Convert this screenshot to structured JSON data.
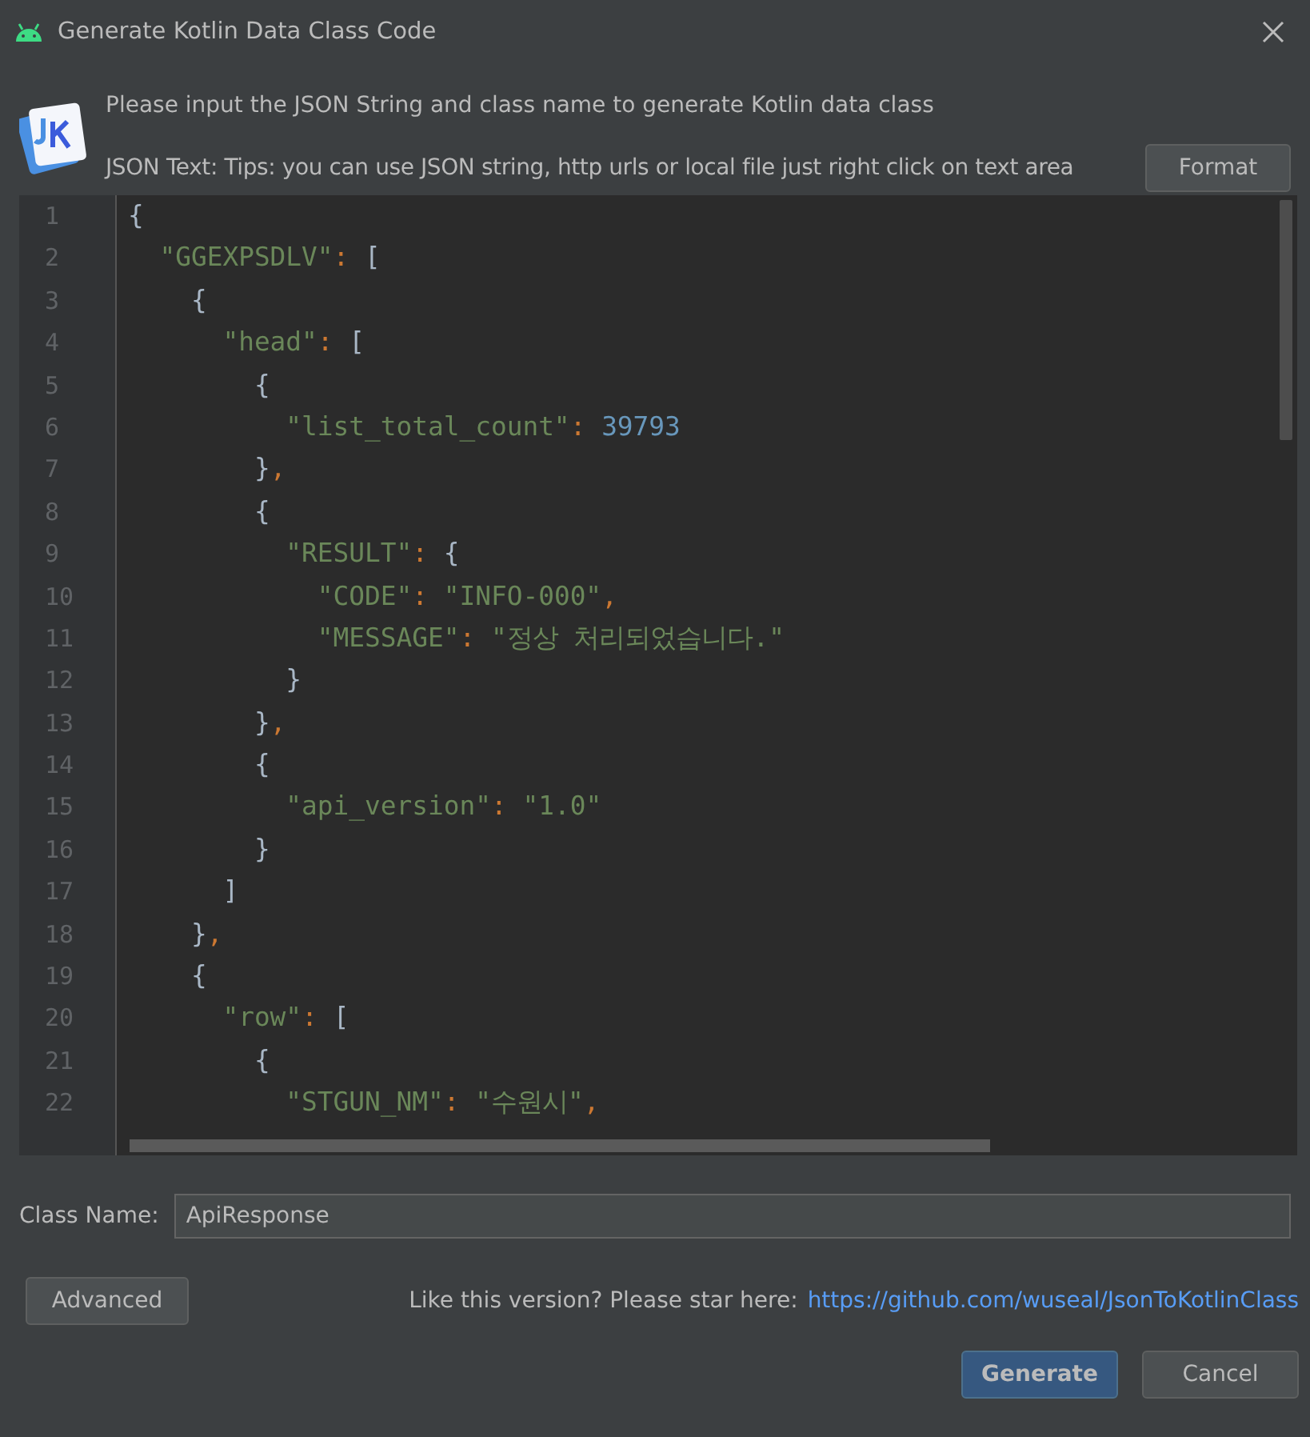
{
  "window": {
    "title": "Generate Kotlin Data Class Code"
  },
  "intro": "Please input the JSON String and class name to generate Kotlin data class",
  "json_label": "JSON Text: Tips: you can use JSON string, http urls or local file just right click on text area",
  "format_button": "Format",
  "editor": {
    "lines": [
      {
        "number": "1",
        "tokens": [
          {
            "kind": "punct",
            "text": "{"
          }
        ]
      },
      {
        "number": "2",
        "tokens": [
          {
            "kind": "key",
            "text": "  \"GGEXPSDLV\""
          },
          {
            "kind": "sep",
            "text": ": "
          },
          {
            "kind": "punct",
            "text": "["
          }
        ]
      },
      {
        "number": "3",
        "tokens": [
          {
            "kind": "punct",
            "text": "    {"
          }
        ]
      },
      {
        "number": "4",
        "tokens": [
          {
            "kind": "key",
            "text": "      \"head\""
          },
          {
            "kind": "sep",
            "text": ": "
          },
          {
            "kind": "punct",
            "text": "["
          }
        ]
      },
      {
        "number": "5",
        "tokens": [
          {
            "kind": "punct",
            "text": "        {"
          }
        ]
      },
      {
        "number": "6",
        "tokens": [
          {
            "kind": "key",
            "text": "          \"list_total_count\""
          },
          {
            "kind": "sep",
            "text": ": "
          },
          {
            "kind": "num",
            "text": "39793"
          }
        ]
      },
      {
        "number": "7",
        "tokens": [
          {
            "kind": "punct",
            "text": "        }"
          },
          {
            "kind": "sep",
            "text": ","
          }
        ]
      },
      {
        "number": "8",
        "tokens": [
          {
            "kind": "punct",
            "text": "        {"
          }
        ]
      },
      {
        "number": "9",
        "tokens": [
          {
            "kind": "key",
            "text": "          \"RESULT\""
          },
          {
            "kind": "sep",
            "text": ": "
          },
          {
            "kind": "punct",
            "text": "{"
          }
        ]
      },
      {
        "number": "10",
        "tokens": [
          {
            "kind": "key",
            "text": "            \"CODE\""
          },
          {
            "kind": "sep",
            "text": ": "
          },
          {
            "kind": "str",
            "text": "\"INFO-000\""
          },
          {
            "kind": "sep",
            "text": ","
          }
        ]
      },
      {
        "number": "11",
        "tokens": [
          {
            "kind": "key",
            "text": "            \"MESSAGE\""
          },
          {
            "kind": "sep",
            "text": ": "
          },
          {
            "kind": "str",
            "text": "\"정상 처리되었습니다.\""
          }
        ]
      },
      {
        "number": "12",
        "tokens": [
          {
            "kind": "punct",
            "text": "          }"
          }
        ]
      },
      {
        "number": "13",
        "tokens": [
          {
            "kind": "punct",
            "text": "        }"
          },
          {
            "kind": "sep",
            "text": ","
          }
        ]
      },
      {
        "number": "14",
        "tokens": [
          {
            "kind": "punct",
            "text": "        {"
          }
        ]
      },
      {
        "number": "15",
        "tokens": [
          {
            "kind": "key",
            "text": "          \"api_version\""
          },
          {
            "kind": "sep",
            "text": ": "
          },
          {
            "kind": "str",
            "text": "\"1.0\""
          }
        ]
      },
      {
        "number": "16",
        "tokens": [
          {
            "kind": "punct",
            "text": "        }"
          }
        ]
      },
      {
        "number": "17",
        "tokens": [
          {
            "kind": "punct",
            "text": "      ]"
          }
        ]
      },
      {
        "number": "18",
        "tokens": [
          {
            "kind": "punct",
            "text": "    }"
          },
          {
            "kind": "sep",
            "text": ","
          }
        ]
      },
      {
        "number": "19",
        "tokens": [
          {
            "kind": "punct",
            "text": "    {"
          }
        ]
      },
      {
        "number": "20",
        "tokens": [
          {
            "kind": "key",
            "text": "      \"row\""
          },
          {
            "kind": "sep",
            "text": ": "
          },
          {
            "kind": "punct",
            "text": "["
          }
        ]
      },
      {
        "number": "21",
        "tokens": [
          {
            "kind": "punct",
            "text": "        {"
          }
        ]
      },
      {
        "number": "22",
        "tokens": [
          {
            "kind": "key",
            "text": "          \"STGUN_NM\""
          },
          {
            "kind": "sep",
            "text": ": "
          },
          {
            "kind": "str",
            "text": "\"수원시\""
          },
          {
            "kind": "sep",
            "text": ","
          }
        ]
      }
    ]
  },
  "class_name": {
    "label": "Class Name:",
    "value": "ApiResponse"
  },
  "advanced_button": "Advanced",
  "star_note": "Like this version? Please star here:",
  "star_link": "https://github.com/wuseal/JsonToKotlinClass",
  "buttons": [
    {
      "label": "Generate",
      "kind": "primary"
    },
    {
      "label": "Cancel",
      "kind": "secondary"
    }
  ]
}
